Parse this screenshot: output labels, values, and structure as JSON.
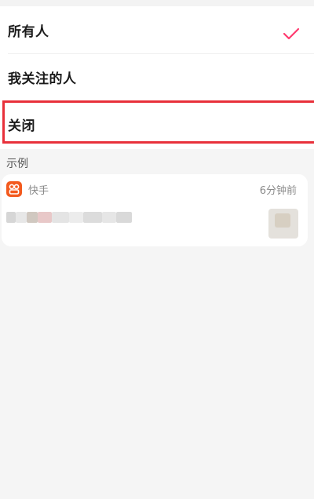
{
  "options": [
    {
      "label": "所有人",
      "selected": true
    },
    {
      "label": "我关注的人",
      "selected": false
    },
    {
      "label": "关闭",
      "selected": false,
      "highlighted": true
    }
  ],
  "colors": {
    "check": "#ff3b6f",
    "highlight_border": "#e8303a",
    "app_icon": "#f35a1e"
  },
  "example": {
    "section_title": "示例",
    "app_name": "快手",
    "time": "6分钟前",
    "app_icon_name": "kuaishou-logo-icon",
    "content": "blurred-preview"
  }
}
